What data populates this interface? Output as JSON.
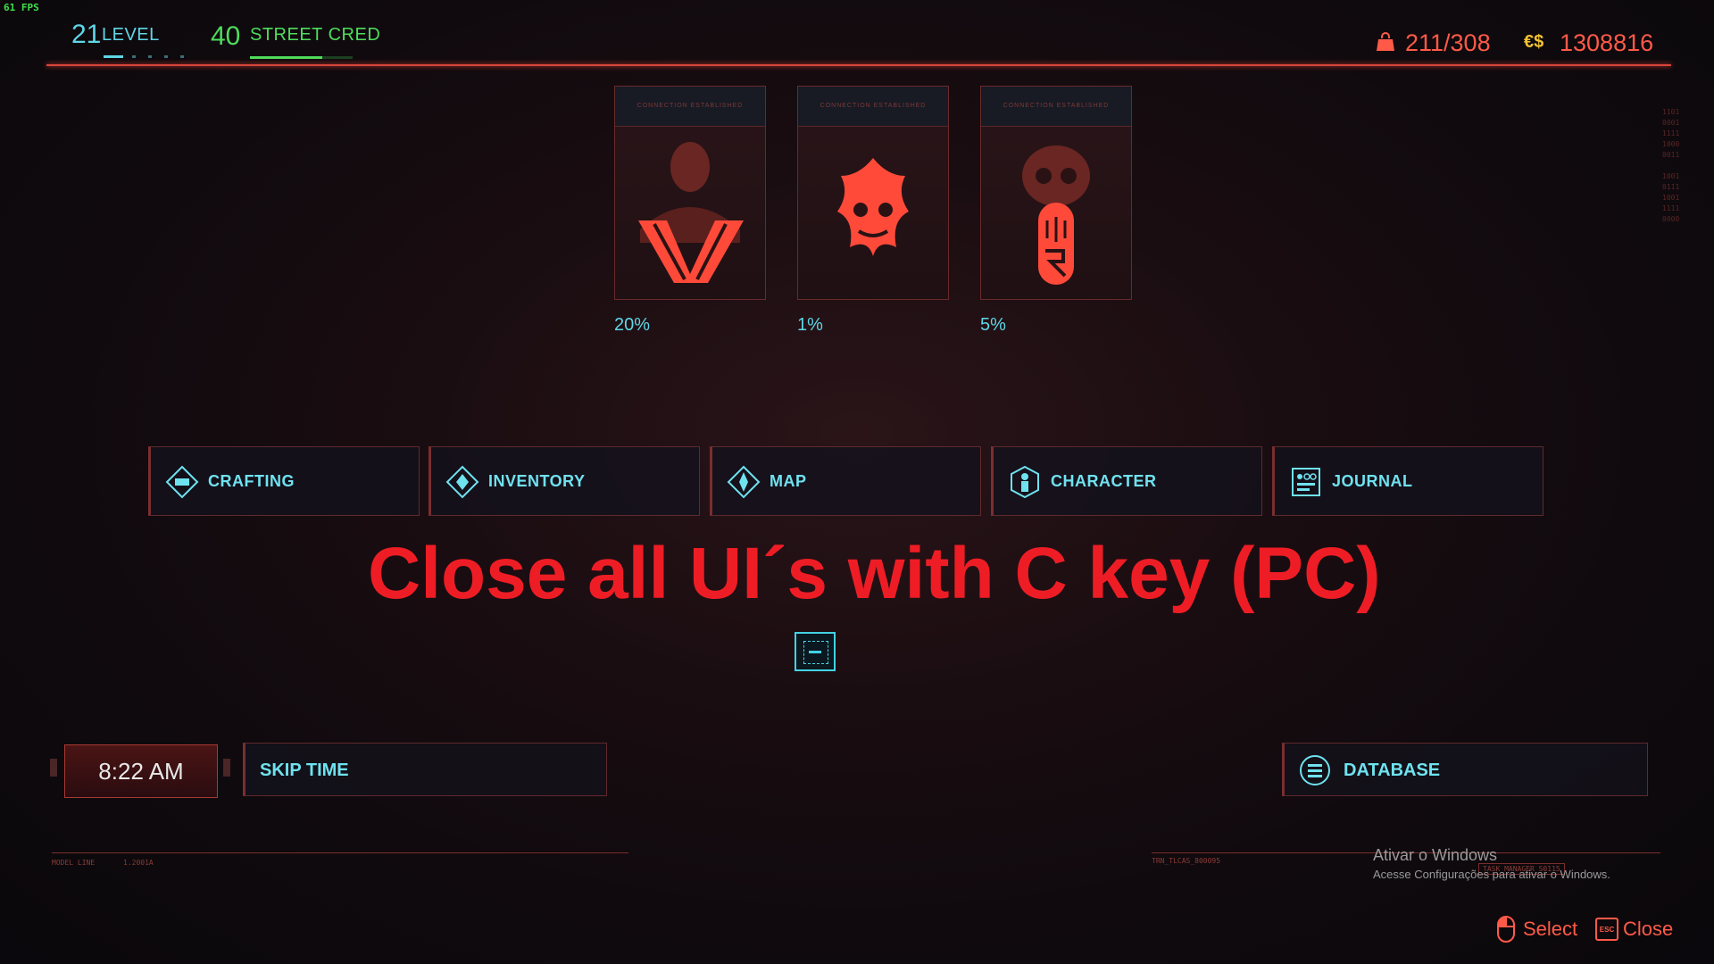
{
  "fps": "61 FPS",
  "header": {
    "level_value": "21",
    "level_label": "LEVEL",
    "street_cred_value": "40",
    "street_cred_label": "STREET CRED",
    "street_cred_progress": 0.7,
    "inventory_capacity": "211/308",
    "money_symbol": "€$",
    "money": "1308816",
    "colors": {
      "accent_red": "#e8433f",
      "level_cyan": "#5fd6e6",
      "cred_green": "#4fdc5c",
      "money_yellow": "#f2c230"
    }
  },
  "factions": [
    {
      "icon": "valentinos-faction-icon",
      "caption": "CONNECTION ESTABLISHED",
      "percent": "20%"
    },
    {
      "icon": "tyger-claws-faction-icon",
      "caption": "CONNECTION ESTABLISHED",
      "percent": "1%"
    },
    {
      "icon": "maelstrom-faction-icon",
      "caption": "CONNECTION ESTABLISHED",
      "percent": "5%"
    }
  ],
  "menu": [
    {
      "label": "CRAFTING",
      "icon": "crafting-icon"
    },
    {
      "label": "INVENTORY",
      "icon": "inventory-icon"
    },
    {
      "label": "MAP",
      "icon": "map-icon"
    },
    {
      "label": "CHARACTER",
      "icon": "character-icon"
    },
    {
      "label": "JOURNAL",
      "icon": "journal-icon"
    }
  ],
  "overlay_banner": "Close all UI´s with C key  (PC)",
  "time": {
    "clock": "8:22 AM",
    "skip_label": "SKIP TIME"
  },
  "database_label": "DATABASE",
  "footer": {
    "model_line_label": "MODEL LINE",
    "model_line_value": "1.2001A",
    "trn_code": "TRN_TLCAS_800095",
    "task_manager": "TASK_MANAGER_S0115"
  },
  "windows_watermark": {
    "title": "Ativar o Windows",
    "subtitle": "Acesse Configurações para ativar o Windows."
  },
  "hints": {
    "select": "Select",
    "esc": "ESC",
    "close": "Close"
  }
}
